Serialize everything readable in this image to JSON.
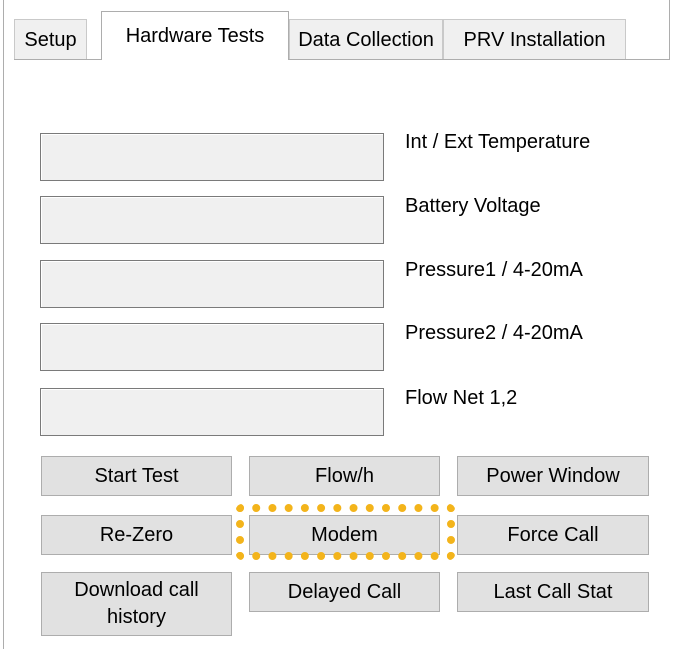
{
  "tabs": [
    "Setup",
    "Hardware Tests",
    "Data Collection",
    "PRV Installation"
  ],
  "active_tab": "Hardware Tests",
  "readouts": [
    {
      "label": "Int / Ext Temperature",
      "value": ""
    },
    {
      "label": "Battery Voltage",
      "value": ""
    },
    {
      "label": "Pressure1 / 4-20mA",
      "value": ""
    },
    {
      "label": "Pressure2 / 4-20mA",
      "value": ""
    },
    {
      "label": "Flow Net 1,2",
      "value": ""
    }
  ],
  "buttons": {
    "start_test": "Start Test",
    "flow_h": "Flow/h",
    "power_window": "Power Window",
    "re_zero": "Re-Zero",
    "modem": "Modem",
    "force_call": "Force Call",
    "download_call_history": "Download call history",
    "delayed_call": "Delayed Call",
    "last_call_stat": "Last Call Stat"
  },
  "colors": {
    "highlight": "#f3b41b",
    "button_face": "#e1e1e1",
    "readout_face": "#f0f0f0"
  }
}
